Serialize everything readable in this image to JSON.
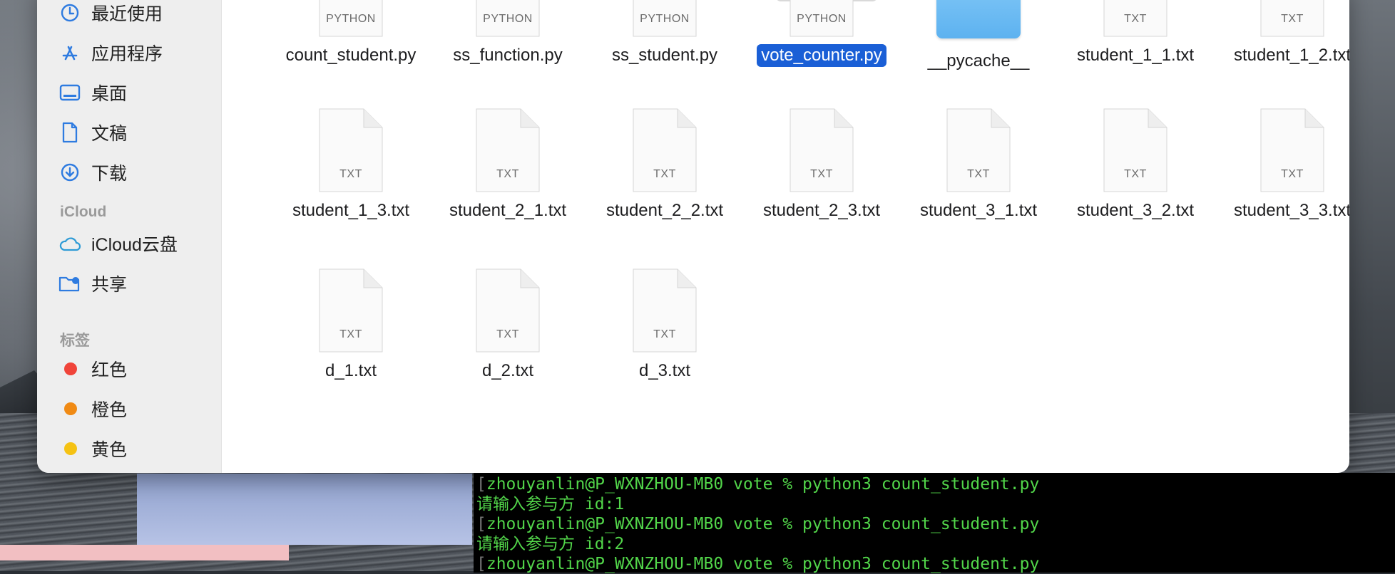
{
  "sidebar": {
    "favorites": [
      {
        "label": "最近使用",
        "icon": "clock-icon"
      },
      {
        "label": "应用程序",
        "icon": "app-store-icon"
      },
      {
        "label": "桌面",
        "icon": "desktop-icon"
      },
      {
        "label": "文稿",
        "icon": "document-icon"
      },
      {
        "label": "下载",
        "icon": "download-icon"
      }
    ],
    "icloud_header": "iCloud",
    "icloud": [
      {
        "label": "iCloud云盘",
        "icon": "cloud-icon"
      },
      {
        "label": "共享",
        "icon": "shared-folder-icon"
      }
    ],
    "tags_header": "标签",
    "tags": [
      {
        "label": "红色",
        "color": "#f0443a"
      },
      {
        "label": "橙色",
        "color": "#f08a14"
      },
      {
        "label": "黄色",
        "color": "#f5c213"
      }
    ]
  },
  "files": [
    {
      "name": "count_student.py",
      "type": "PYTHON"
    },
    {
      "name": "ss_function.py",
      "type": "PYTHON"
    },
    {
      "name": "ss_student.py",
      "type": "PYTHON"
    },
    {
      "name": "vote_counter.py",
      "type": "PYTHON",
      "selected": true
    },
    {
      "name": "__pycache__",
      "type": "folder"
    },
    {
      "name": "student_1_1.txt",
      "type": "TXT"
    },
    {
      "name": "student_1_2.txt",
      "type": "TXT"
    },
    {
      "name": "student_1_3.txt",
      "type": "TXT"
    },
    {
      "name": "student_2_1.txt",
      "type": "TXT"
    },
    {
      "name": "student_2_2.txt",
      "type": "TXT"
    },
    {
      "name": "student_2_3.txt",
      "type": "TXT"
    },
    {
      "name": "student_3_1.txt",
      "type": "TXT"
    },
    {
      "name": "student_3_2.txt",
      "type": "TXT"
    },
    {
      "name": "student_3_3.txt",
      "type": "TXT"
    },
    {
      "name": "d_1.txt",
      "type": "TXT"
    },
    {
      "name": "d_2.txt",
      "type": "TXT"
    },
    {
      "name": "d_3.txt",
      "type": "TXT"
    }
  ],
  "terminal": {
    "lines": [
      "zhouyanlin@P_WXNZHOU-MB0 vote % python3 count_student.py",
      "请输入参与方 id:1",
      "zhouyanlin@P_WXNZHOU-MB0 vote % python3 count_student.py",
      "请输入参与方 id:2",
      "zhouyanlin@P_WXNZHOU-MB0 vote % python3 count_student.py"
    ]
  }
}
